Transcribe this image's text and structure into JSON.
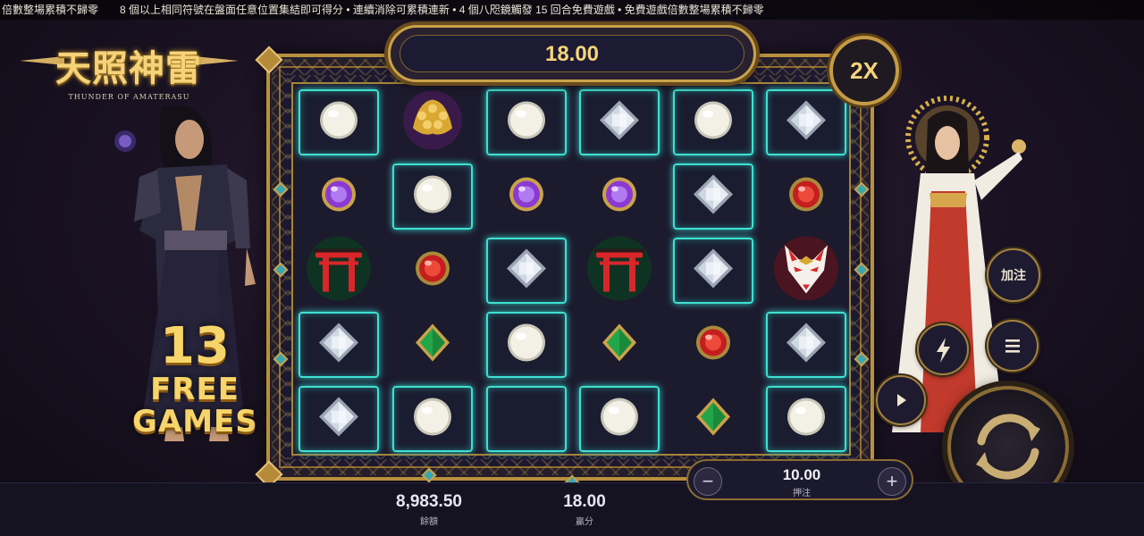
{
  "ticker": "倍數整場累積不歸零　　8 個以上相同符號在盤面任意位置集結即可得分 • 連續消除可累積連新 • 4 個八咫鏡觸發 15 回合免費遊戲 • 免費遊戲倍數整場累積不歸零",
  "logo": {
    "title": "天照神雷",
    "subtitle": "THUNDER OF AMATERASU"
  },
  "free_games": {
    "count": "13",
    "line1": "FREE",
    "line2": "GAMES"
  },
  "win_display": "18.00",
  "multiplier": "2X",
  "grid": [
    [
      {
        "s": "pearl",
        "hl": true
      },
      {
        "s": "dragon",
        "hl": false
      },
      {
        "s": "pearl",
        "hl": true
      },
      {
        "s": "diamond",
        "hl": true
      },
      {
        "s": "pearl",
        "hl": true
      },
      {
        "s": "diamond",
        "hl": true
      }
    ],
    [
      {
        "s": "amethyst",
        "hl": false
      },
      {
        "s": "pearl",
        "hl": true
      },
      {
        "s": "amethyst",
        "hl": false
      },
      {
        "s": "amethyst",
        "hl": false
      },
      {
        "s": "diamond",
        "hl": true
      },
      {
        "s": "ruby",
        "hl": false
      }
    ],
    [
      {
        "s": "torii",
        "hl": false
      },
      {
        "s": "ruby",
        "hl": false
      },
      {
        "s": "diamond",
        "hl": true
      },
      {
        "s": "torii",
        "hl": false
      },
      {
        "s": "diamond",
        "hl": true
      },
      {
        "s": "fox-mask",
        "hl": false
      }
    ],
    [
      {
        "s": "diamond",
        "hl": true
      },
      {
        "s": "emerald",
        "hl": false
      },
      {
        "s": "pearl",
        "hl": true
      },
      {
        "s": "emerald",
        "hl": false
      },
      {
        "s": "ruby",
        "hl": false
      },
      {
        "s": "diamond",
        "hl": true
      }
    ],
    [
      {
        "s": "diamond",
        "hl": true
      },
      {
        "s": "pearl",
        "hl": true
      },
      {
        "s": "empty",
        "hl": true
      },
      {
        "s": "pearl",
        "hl": true
      },
      {
        "s": "emerald",
        "hl": false
      },
      {
        "s": "pearl",
        "hl": true
      }
    ]
  ],
  "balance": {
    "value": "8,983.50",
    "label": "餘額"
  },
  "win": {
    "value": "18.00",
    "label": "贏分"
  },
  "bet": {
    "value": "10.00",
    "label": "押注",
    "minus": "−",
    "plus": "+"
  },
  "buttons": {
    "add_bet": "加注",
    "turbo_icon": "lightning-icon",
    "menu_icon": "menu-icon",
    "autoplay_icon": "play-icon",
    "spin_icon": "spin-arrows-icon"
  },
  "colors": {
    "gold": "#c9a24a",
    "teal_highlight": "#3fe0d0",
    "win_text": "#f7d47a"
  }
}
